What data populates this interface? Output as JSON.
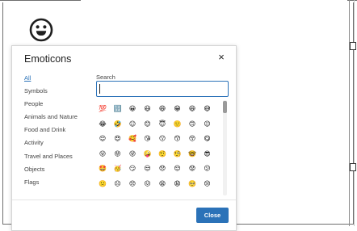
{
  "dialog": {
    "title": "Emoticons",
    "close_icon": "×",
    "close_button": "Close"
  },
  "sidebar": {
    "categories": [
      {
        "label": "All",
        "active": true
      },
      {
        "label": "Symbols"
      },
      {
        "label": "People"
      },
      {
        "label": "Animals and Nature"
      },
      {
        "label": "Food and Drink"
      },
      {
        "label": "Activity"
      },
      {
        "label": "Travel and Places"
      },
      {
        "label": "Objects"
      },
      {
        "label": "Flags"
      }
    ]
  },
  "search": {
    "label": "Search",
    "value": "",
    "placeholder": ""
  },
  "emoji_grid": {
    "rows": [
      [
        "💯",
        "🔢",
        "😀",
        "😃",
        "😄",
        "😁",
        "😆",
        "😅"
      ],
      [
        "😂",
        "🤣",
        "☺",
        "😊",
        "😇",
        "🙂",
        "🙃",
        "😉"
      ],
      [
        "😌",
        "😍",
        "🥰",
        "😘",
        "😗",
        "😙",
        "😚",
        "😋"
      ],
      [
        "😛",
        "😝",
        "😜",
        "🤪",
        "🤨",
        "🧐",
        "🤓",
        "😎"
      ],
      [
        "🤩",
        "🥳",
        "😏",
        "😒",
        "😞",
        "😔",
        "😟",
        "😕"
      ],
      [
        "🙁",
        "☹",
        "😣",
        "😖",
        "😫",
        "😩",
        "🥺",
        "😢"
      ]
    ]
  },
  "colors": {
    "accent": "#2b72b8",
    "emoji_face": "#f6c744"
  },
  "icons": {
    "header": "smiley-face-icon",
    "close": "close-icon"
  }
}
